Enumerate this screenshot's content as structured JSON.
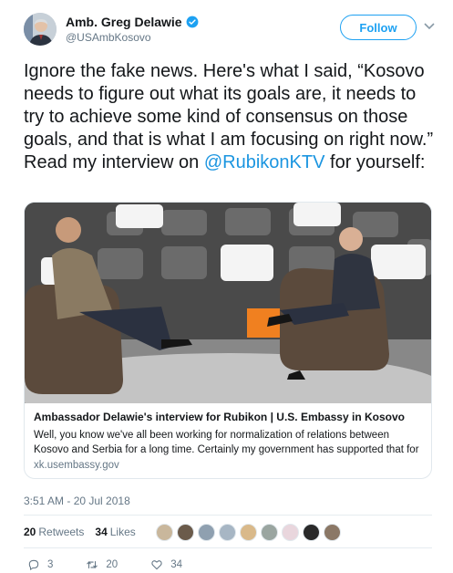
{
  "author": {
    "name": "Amb. Greg Delawie",
    "handle": "@USAmbKosovo"
  },
  "follow_label": "Follow",
  "tweet": {
    "text_before": "Ignore the fake news. Here's what I said, “Kosovo needs to figure out what its goals are, it needs to try to achieve some kind of consensus on those goals, and that is what I am focusing on right now.” Read my interview on ",
    "mention": "@RubikonKTV",
    "text_after": " for yourself:"
  },
  "card": {
    "title": "Ambassador Delawie's interview for Rubikon | U.S. Embassy in Kosovo",
    "description": "Well, you know we've all been working for normalization of relations between Kosovo and Serbia for a long time. Certainly my government has supported that for a long t...",
    "url": "xk.usembassy.gov"
  },
  "timestamp": "3:51 AM - 20 Jul 2018",
  "stats": {
    "retweets_count": "20",
    "retweets_label": "Retweets",
    "likes_count": "34",
    "likes_label": "Likes"
  },
  "likers": [
    "#c9b79c",
    "#6b5b4b",
    "#8fa0b0",
    "#a7b6c4",
    "#d9b98a",
    "#9aa5a0",
    "#e9d6dd",
    "#2a2a2a",
    "#8b7866"
  ],
  "actions": {
    "replies": "3",
    "retweets": "20",
    "likes": "34"
  },
  "colors": {
    "accent": "#1da1f2",
    "link": "#1b95e0",
    "muted": "#657786"
  }
}
